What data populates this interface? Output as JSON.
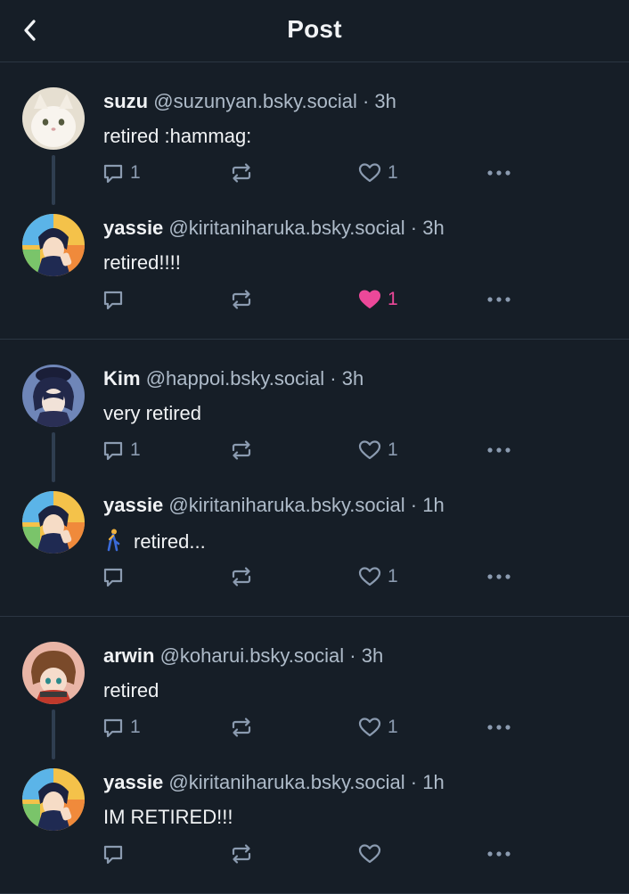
{
  "header": {
    "title": "Post"
  },
  "threads": [
    {
      "parent": {
        "name": "suzu",
        "handle": "@suzunyan.bsky.social",
        "time": "3h",
        "text": "retired :hammag:",
        "reply_count": "1",
        "like_count": "1",
        "repost_count": "",
        "liked": false
      },
      "reply": {
        "name": "yassie",
        "handle": "@kiritaniharuka.bsky.social",
        "time": "3h",
        "text": "retired!!!!",
        "reply_count": "",
        "like_count": "1",
        "repost_count": "",
        "liked": true
      }
    },
    {
      "parent": {
        "name": "Kim",
        "handle": "@happoi.bsky.social",
        "time": "3h",
        "text": "very retired",
        "reply_count": "1",
        "like_count": "1",
        "repost_count": "",
        "liked": false
      },
      "reply": {
        "name": "yassie",
        "handle": "@kiritaniharuka.bsky.social",
        "time": "1h",
        "text": "retired...",
        "reply_count": "",
        "like_count": "1",
        "repost_count": "",
        "liked": false,
        "emoji_icon": "person-walking-emoji"
      }
    },
    {
      "parent": {
        "name": "arwin",
        "handle": "@koharui.bsky.social",
        "time": "3h",
        "text": "retired",
        "reply_count": "1",
        "like_count": "1",
        "repost_count": "",
        "liked": false
      },
      "reply": {
        "name": "yassie",
        "handle": "@kiritaniharuka.bsky.social",
        "time": "1h",
        "text": "IM RETIRED!!!",
        "reply_count": "",
        "like_count": "",
        "repost_count": "",
        "liked": false
      }
    }
  ],
  "colors": {
    "background": "#161e27",
    "divider": "#2b3642",
    "icon": "#8b9bb0",
    "like_active": "#ec4899",
    "muted_text": "#aebbc9"
  },
  "icons": {
    "back": "chevron-left-icon",
    "reply": "speech-bubble-icon",
    "repost": "repost-icon",
    "like": "heart-icon",
    "more": "more-dots-icon"
  }
}
